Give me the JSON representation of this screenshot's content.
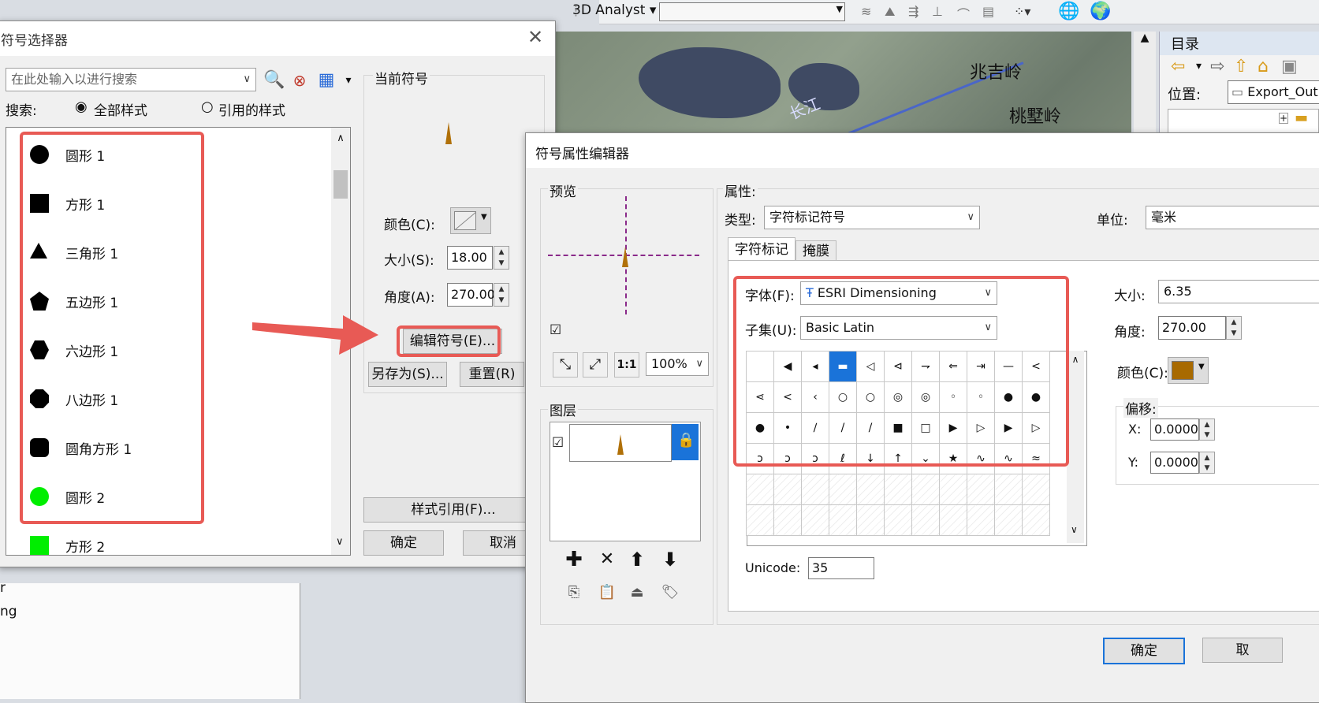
{
  "toolbar": {
    "analyst_label": "3D Analyst"
  },
  "map": {
    "places": [
      "兆吉岭",
      "桃墅岭"
    ],
    "river": "长江"
  },
  "toc": {
    "title": "目录",
    "location_label": "位置:",
    "location_value": "Export_Out"
  },
  "left_panel": {
    "items": [
      "r",
      "ng"
    ]
  },
  "selector": {
    "title": "符号选择器",
    "search_placeholder": "在此处输入以进行搜索",
    "search_label": "搜索:",
    "radio_all": "全部样式",
    "radio_ref": "引用的样式",
    "symbols": [
      {
        "name": "圆形 1",
        "shape": "circle",
        "color": "#000000"
      },
      {
        "name": "方形 1",
        "shape": "square",
        "color": "#000000"
      },
      {
        "name": "三角形 1",
        "shape": "triangle",
        "color": "#000000"
      },
      {
        "name": "五边形 1",
        "shape": "pentagon",
        "color": "#000000"
      },
      {
        "name": "六边形 1",
        "shape": "hexagon",
        "color": "#000000"
      },
      {
        "name": "八边形 1",
        "shape": "octagon",
        "color": "#000000"
      },
      {
        "name": "圆角方形 1",
        "shape": "rounded-square",
        "color": "#000000"
      },
      {
        "name": "圆形 2",
        "shape": "circle",
        "color": "#00ee00"
      },
      {
        "name": "方形 2",
        "shape": "square",
        "color": "#00ee00"
      }
    ],
    "current_symbol_label": "当前符号",
    "color_label": "颜色(C):",
    "size_label": "大小(S):",
    "size_value": "18.00",
    "angle_label": "角度(A):",
    "angle_value": "270.00",
    "edit_button": "编辑符号(E)...",
    "save_as_button": "另存为(S)...",
    "reset_button": "重置(R)",
    "style_ref_button": "样式引用(F)...",
    "ok_button": "确定",
    "cancel_button": "取消"
  },
  "editor": {
    "title": "符号属性编辑器",
    "preview_label": "预览",
    "zoom_value": "100%",
    "layers_label": "图层",
    "properties_label": "属性:",
    "type_label": "类型:",
    "type_value": "字符标记符号",
    "unit_label": "单位:",
    "unit_value": "毫米",
    "tab_char": "字符标记",
    "tab_mask": "掩膜",
    "font_label": "字体(F):",
    "font_value": "ESRI Dimensioning",
    "subset_label": "子集(U):",
    "subset_value": "Basic Latin",
    "size_label": "大小:",
    "size_value": "6.35",
    "angle_label": "角度:",
    "angle_value": "270.00",
    "color_label": "颜色(C):",
    "color_value": "#a86a00",
    "offset_label": "偏移:",
    "x_label": "X:",
    "x_value": "0.0000",
    "y_label": "Y:",
    "y_value": "0.0000",
    "unicode_label": "Unicode:",
    "unicode_value": "35",
    "ok_button": "确定",
    "cancel_button": "取",
    "glyph_rows": [
      [
        "",
        "◀",
        "◂",
        "▬",
        "◁",
        "⊲",
        "⇁",
        "⇐",
        "⇥",
        "—",
        "<"
      ],
      [
        "⋖",
        "<",
        "‹",
        "○",
        "○",
        "◎",
        "◎",
        "◦",
        "◦",
        "●",
        "●"
      ],
      [
        "●",
        "•",
        "∕",
        "/",
        "/",
        "■",
        "□",
        "▶",
        "▷",
        "▶",
        "▷"
      ],
      [
        "ɔ",
        "ɔ",
        "ɔ",
        "ℓ",
        "↓",
        "↑",
        "⌄",
        "★",
        "∿",
        "∿",
        "≈"
      ],
      [
        "",
        "",
        "",
        "",
        "",
        "",
        "",
        "",
        "",
        "",
        ""
      ],
      [
        "",
        "",
        "",
        "",
        "",
        "",
        "",
        "",
        "",
        "",
        ""
      ]
    ],
    "selected_glyph": "0-3"
  }
}
